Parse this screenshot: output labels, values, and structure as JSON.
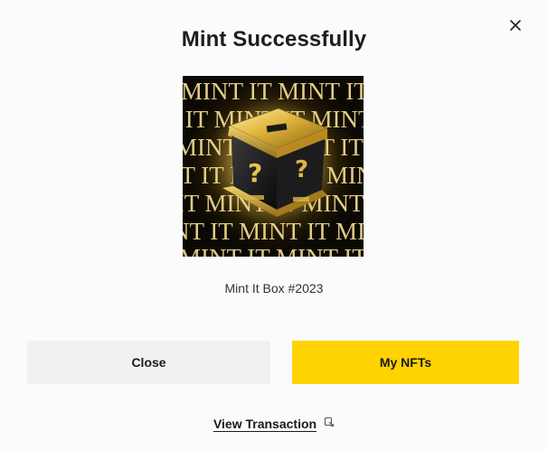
{
  "dialog": {
    "title": "Mint Successfully",
    "nft_name": "Mint It Box #2023",
    "image_text": "MINT IT",
    "box_label": "MINT IT"
  },
  "buttons": {
    "close_label": "Close",
    "my_nfts_label": "My NFTs"
  },
  "link": {
    "view_transaction_label": "View Transaction"
  },
  "icons": {
    "close": "close-icon",
    "external_link": "external-link-icon"
  },
  "colors": {
    "primary_button": "#ffd300",
    "secondary_button": "#f1f1f1",
    "background": "#fbfbfb"
  }
}
